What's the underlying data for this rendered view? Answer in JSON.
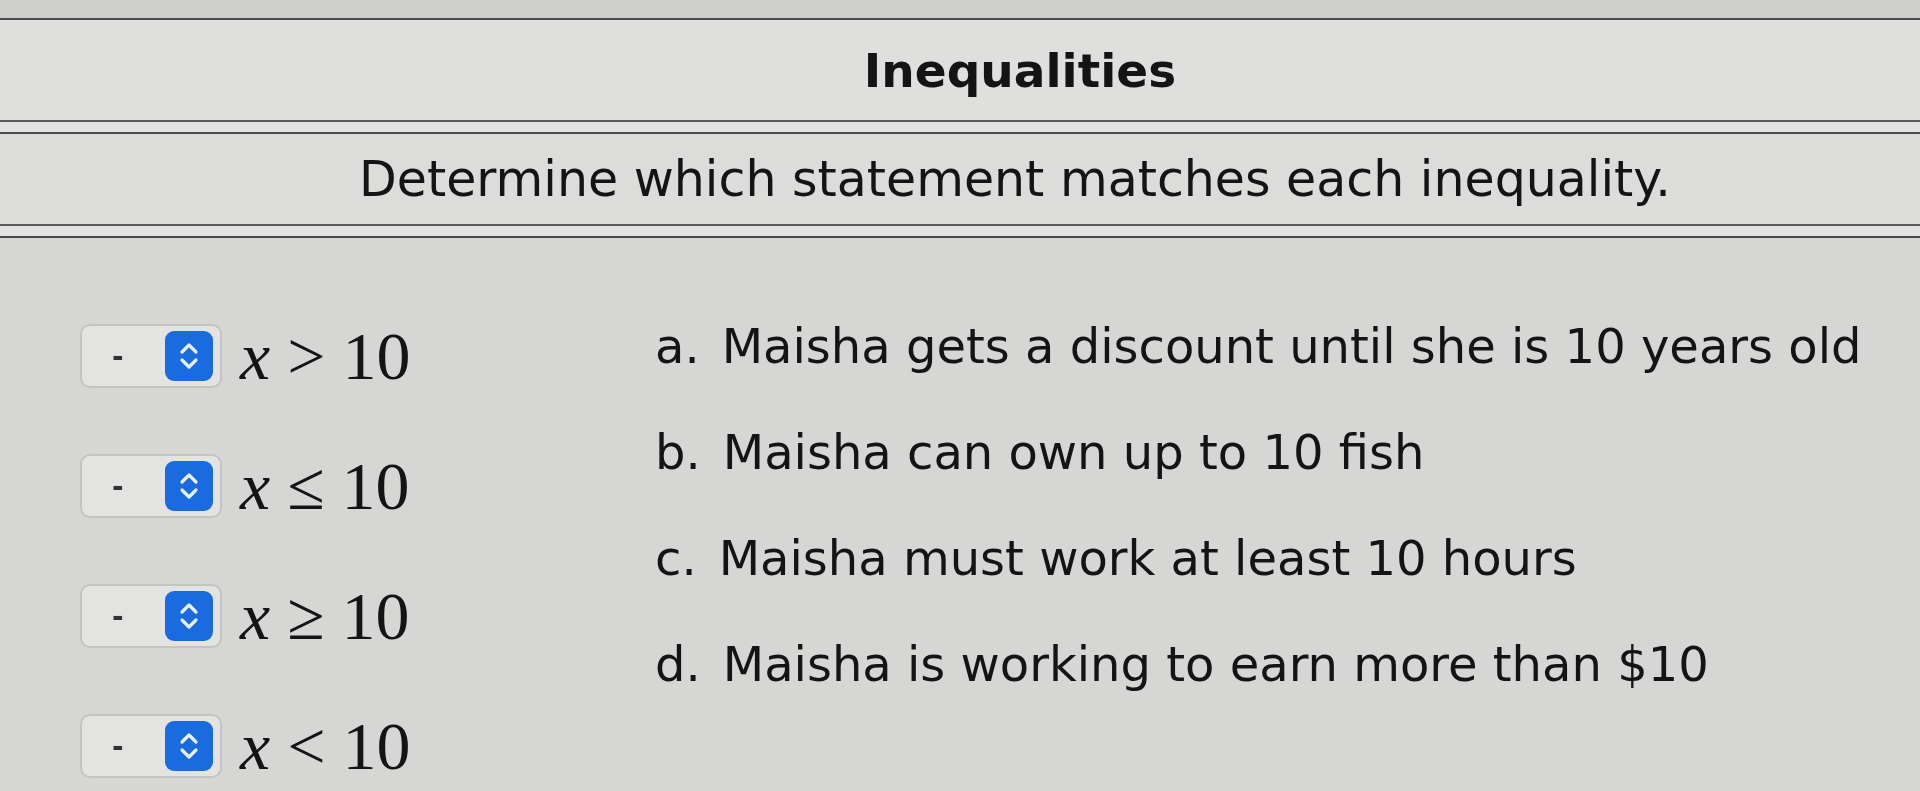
{
  "header": {
    "title": "Inequalities",
    "instruction": "Determine which statement matches each inequality."
  },
  "inequalities": [
    {
      "value": "-",
      "expression": "*x* > 10"
    },
    {
      "value": "-",
      "expression": "*x* ≤ 10"
    },
    {
      "value": "-",
      "expression": "*x* ≥ 10"
    },
    {
      "value": "-",
      "expression": "*x* < 10"
    }
  ],
  "statements": [
    {
      "letter": "a.",
      "text": "Maisha gets a discount until she is 10 years old"
    },
    {
      "letter": "b.",
      "text": "Maisha can own up to 10 fish"
    },
    {
      "letter": "c.",
      "text": "Maisha must work at least 10 hours"
    },
    {
      "letter": "d.",
      "text": "Maisha is working to earn more than $10"
    }
  ]
}
